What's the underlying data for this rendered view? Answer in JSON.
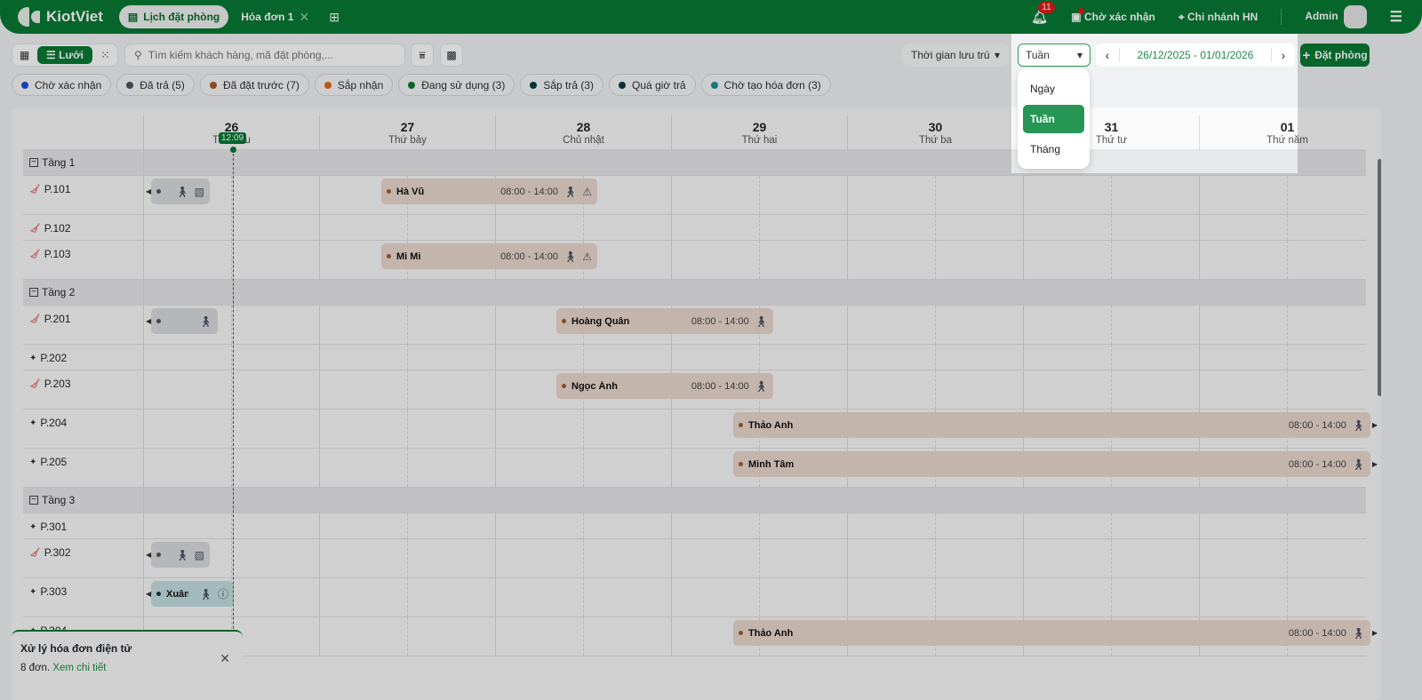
{
  "app": {
    "name": "KiotViet",
    "tabs": [
      {
        "label": "Lịch đặt phòng",
        "active": true
      },
      {
        "label": "Hóa đơn 1",
        "active": false
      }
    ]
  },
  "topbar": {
    "notifications": "11",
    "pending": "Chờ xác nhận",
    "branch": "Chi nhánh HN",
    "user": "Admin"
  },
  "toolbar": {
    "view_active": "Lưới",
    "search_placeholder": "Tìm kiếm khách hàng, mã đặt phòng,...",
    "stay_time": "Thời gian lưu trú",
    "mode": "Tuần",
    "date_range": "26/12/2025 - 01/01/2026",
    "book_label": "Đặt phòng"
  },
  "mode_options": [
    {
      "label": "Ngày"
    },
    {
      "label": "Tuần",
      "selected": true
    },
    {
      "label": "Tháng"
    }
  ],
  "status_chips": [
    {
      "label": "Chờ xác nhận",
      "color": "#1a4fd6"
    },
    {
      "label": "Đã trả (5)",
      "color": "#4b5563"
    },
    {
      "label": "Đã đặt trước (7)",
      "color": "#a45a2a"
    },
    {
      "label": "Sắp nhận",
      "color": "#e56a10"
    },
    {
      "label": "Đang sử dụng (3)",
      "color": "#157a32"
    },
    {
      "label": "Sắp trả (3)",
      "color": "#0e3b44"
    },
    {
      "label": "Quá giờ trả",
      "color": "#0e3b44"
    },
    {
      "label": "Chờ tạo hóa đơn (3)",
      "color": "#149199"
    }
  ],
  "days": [
    {
      "num": "26",
      "weekday": "Thứ sáu"
    },
    {
      "num": "27",
      "weekday": "Thứ bảy"
    },
    {
      "num": "28",
      "weekday": "Chủ nhật"
    },
    {
      "num": "29",
      "weekday": "Thứ hai"
    },
    {
      "num": "30",
      "weekday": "Thứ ba"
    },
    {
      "num": "31",
      "weekday": "Thứ tư"
    },
    {
      "num": "01",
      "weekday": "Thứ năm"
    }
  ],
  "current_time": "12:09",
  "rows": [
    {
      "type": "floor",
      "label": "Tầng 1"
    },
    {
      "type": "room",
      "label": "P.101",
      "status_icon": "broom-icon",
      "bookings": [
        {
          "style": "gray",
          "name": "",
          "dot": "#4b5563",
          "icons": [
            "walk-icon",
            "doc-check-icon"
          ]
        }
      ]
    },
    {
      "type": "room",
      "label": "P.102",
      "status_icon": "broom-icon",
      "bookings": []
    },
    {
      "type": "room",
      "label": "P.103",
      "status_icon": "broom-icon",
      "bookings": [
        {
          "style": "brown",
          "name": "Mi Mi",
          "time": "08:00 - 14:00",
          "dot": "#a45a2a",
          "icons": [
            "walk-icon",
            "warning-icon"
          ]
        }
      ]
    },
    {
      "type": "floor",
      "label": "Tầng 2"
    },
    {
      "type": "room",
      "label": "P.201",
      "status_icon": "broom-icon",
      "bookings": [
        {
          "style": "gray",
          "name": "",
          "dot": "#4b5563",
          "icons": [
            "walk-icon"
          ]
        }
      ]
    },
    {
      "type": "room",
      "label": "P.202",
      "status_icon": "sparkle-icon",
      "bookings": []
    },
    {
      "type": "room",
      "label": "P.203",
      "status_icon": "broom-icon",
      "bookings": [
        {
          "style": "brown",
          "name": "Ngọc Ánh",
          "time": "08:00 - 14:00",
          "dot": "#a45a2a",
          "icons": [
            "walk-icon"
          ]
        }
      ]
    },
    {
      "type": "room",
      "label": "P.204",
      "status_icon": "sparkle-icon",
      "bookings": [
        {
          "style": "brown",
          "name": "Thảo Anh",
          "time": "08:00 - 14:00",
          "dot": "#a45a2a",
          "icons": [
            "walk-icon"
          ]
        }
      ]
    },
    {
      "type": "room",
      "label": "P.205",
      "status_icon": "sparkle-icon",
      "bookings": [
        {
          "style": "brown",
          "name": "Minh Tâm",
          "time": "08:00 - 14:00",
          "dot": "#a45a2a",
          "icons": [
            "walk-icon"
          ]
        }
      ]
    },
    {
      "type": "floor",
      "label": "Tầng 3"
    },
    {
      "type": "room",
      "label": "P.301",
      "status_icon": "sparkle-icon",
      "bookings": []
    },
    {
      "type": "room",
      "label": "P.302",
      "status_icon": "broom-icon",
      "bookings": [
        {
          "style": "gray",
          "name": "",
          "dot": "#4b5563",
          "icons": [
            "walk-icon",
            "doc-check-icon"
          ]
        }
      ]
    },
    {
      "type": "room",
      "label": "P.303",
      "status_icon": "sparkle-icon",
      "bookings": [
        {
          "style": "teal",
          "name": "Xuân ...",
          "dot": "#0e3b44",
          "icons": [
            "walk-icon",
            "info-icon"
          ]
        }
      ]
    },
    {
      "type": "room",
      "label": "P.304",
      "status_icon": "sparkle-icon",
      "bookings": [
        {
          "style": "brown",
          "name": "Thảo Anh",
          "time": "08:00 - 14:00",
          "dot": "#a45a2a",
          "icons": [
            "walk-icon"
          ]
        }
      ]
    }
  ],
  "p101_extra": {
    "style": "brown",
    "name": "Hà Vũ",
    "time": "08:00 - 14:00",
    "dot": "#a45a2a",
    "icons": [
      "walk-icon",
      "warning-icon"
    ]
  },
  "p201_extra": {
    "style": "brown",
    "name": "Hoàng Quân",
    "time": "08:00 - 14:00",
    "dot": "#a45a2a",
    "icons": [
      "walk-icon"
    ]
  },
  "toast": {
    "title": "Xử lý hóa đơn điện tử",
    "count": "8 đơn.",
    "link": "Xem chi tiết"
  }
}
